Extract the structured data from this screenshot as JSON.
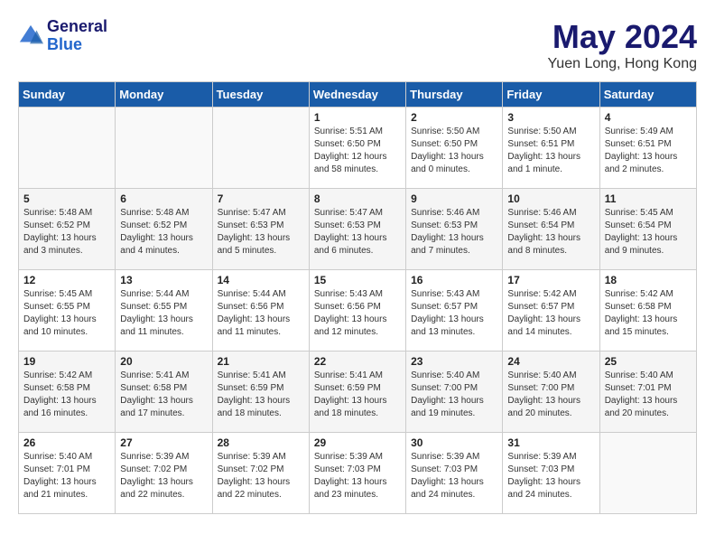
{
  "header": {
    "logo_line1": "General",
    "logo_line2": "Blue",
    "month": "May 2024",
    "location": "Yuen Long, Hong Kong"
  },
  "weekdays": [
    "Sunday",
    "Monday",
    "Tuesday",
    "Wednesday",
    "Thursday",
    "Friday",
    "Saturday"
  ],
  "weeks": [
    [
      {
        "day": "",
        "info": ""
      },
      {
        "day": "",
        "info": ""
      },
      {
        "day": "",
        "info": ""
      },
      {
        "day": "1",
        "info": "Sunrise: 5:51 AM\nSunset: 6:50 PM\nDaylight: 12 hours\nand 58 minutes."
      },
      {
        "day": "2",
        "info": "Sunrise: 5:50 AM\nSunset: 6:50 PM\nDaylight: 13 hours\nand 0 minutes."
      },
      {
        "day": "3",
        "info": "Sunrise: 5:50 AM\nSunset: 6:51 PM\nDaylight: 13 hours\nand 1 minute."
      },
      {
        "day": "4",
        "info": "Sunrise: 5:49 AM\nSunset: 6:51 PM\nDaylight: 13 hours\nand 2 minutes."
      }
    ],
    [
      {
        "day": "5",
        "info": "Sunrise: 5:48 AM\nSunset: 6:52 PM\nDaylight: 13 hours\nand 3 minutes."
      },
      {
        "day": "6",
        "info": "Sunrise: 5:48 AM\nSunset: 6:52 PM\nDaylight: 13 hours\nand 4 minutes."
      },
      {
        "day": "7",
        "info": "Sunrise: 5:47 AM\nSunset: 6:53 PM\nDaylight: 13 hours\nand 5 minutes."
      },
      {
        "day": "8",
        "info": "Sunrise: 5:47 AM\nSunset: 6:53 PM\nDaylight: 13 hours\nand 6 minutes."
      },
      {
        "day": "9",
        "info": "Sunrise: 5:46 AM\nSunset: 6:53 PM\nDaylight: 13 hours\nand 7 minutes."
      },
      {
        "day": "10",
        "info": "Sunrise: 5:46 AM\nSunset: 6:54 PM\nDaylight: 13 hours\nand 8 minutes."
      },
      {
        "day": "11",
        "info": "Sunrise: 5:45 AM\nSunset: 6:54 PM\nDaylight: 13 hours\nand 9 minutes."
      }
    ],
    [
      {
        "day": "12",
        "info": "Sunrise: 5:45 AM\nSunset: 6:55 PM\nDaylight: 13 hours\nand 10 minutes."
      },
      {
        "day": "13",
        "info": "Sunrise: 5:44 AM\nSunset: 6:55 PM\nDaylight: 13 hours\nand 11 minutes."
      },
      {
        "day": "14",
        "info": "Sunrise: 5:44 AM\nSunset: 6:56 PM\nDaylight: 13 hours\nand 11 minutes."
      },
      {
        "day": "15",
        "info": "Sunrise: 5:43 AM\nSunset: 6:56 PM\nDaylight: 13 hours\nand 12 minutes."
      },
      {
        "day": "16",
        "info": "Sunrise: 5:43 AM\nSunset: 6:57 PM\nDaylight: 13 hours\nand 13 minutes."
      },
      {
        "day": "17",
        "info": "Sunrise: 5:42 AM\nSunset: 6:57 PM\nDaylight: 13 hours\nand 14 minutes."
      },
      {
        "day": "18",
        "info": "Sunrise: 5:42 AM\nSunset: 6:58 PM\nDaylight: 13 hours\nand 15 minutes."
      }
    ],
    [
      {
        "day": "19",
        "info": "Sunrise: 5:42 AM\nSunset: 6:58 PM\nDaylight: 13 hours\nand 16 minutes."
      },
      {
        "day": "20",
        "info": "Sunrise: 5:41 AM\nSunset: 6:58 PM\nDaylight: 13 hours\nand 17 minutes."
      },
      {
        "day": "21",
        "info": "Sunrise: 5:41 AM\nSunset: 6:59 PM\nDaylight: 13 hours\nand 18 minutes."
      },
      {
        "day": "22",
        "info": "Sunrise: 5:41 AM\nSunset: 6:59 PM\nDaylight: 13 hours\nand 18 minutes."
      },
      {
        "day": "23",
        "info": "Sunrise: 5:40 AM\nSunset: 7:00 PM\nDaylight: 13 hours\nand 19 minutes."
      },
      {
        "day": "24",
        "info": "Sunrise: 5:40 AM\nSunset: 7:00 PM\nDaylight: 13 hours\nand 20 minutes."
      },
      {
        "day": "25",
        "info": "Sunrise: 5:40 AM\nSunset: 7:01 PM\nDaylight: 13 hours\nand 20 minutes."
      }
    ],
    [
      {
        "day": "26",
        "info": "Sunrise: 5:40 AM\nSunset: 7:01 PM\nDaylight: 13 hours\nand 21 minutes."
      },
      {
        "day": "27",
        "info": "Sunrise: 5:39 AM\nSunset: 7:02 PM\nDaylight: 13 hours\nand 22 minutes."
      },
      {
        "day": "28",
        "info": "Sunrise: 5:39 AM\nSunset: 7:02 PM\nDaylight: 13 hours\nand 22 minutes."
      },
      {
        "day": "29",
        "info": "Sunrise: 5:39 AM\nSunset: 7:03 PM\nDaylight: 13 hours\nand 23 minutes."
      },
      {
        "day": "30",
        "info": "Sunrise: 5:39 AM\nSunset: 7:03 PM\nDaylight: 13 hours\nand 24 minutes."
      },
      {
        "day": "31",
        "info": "Sunrise: 5:39 AM\nSunset: 7:03 PM\nDaylight: 13 hours\nand 24 minutes."
      },
      {
        "day": "",
        "info": ""
      }
    ]
  ]
}
